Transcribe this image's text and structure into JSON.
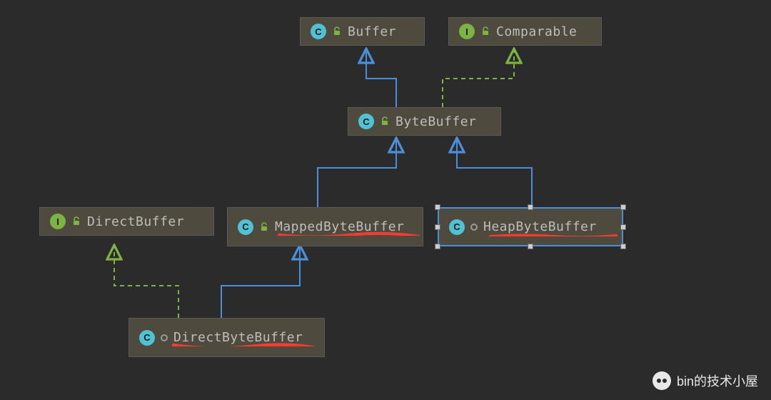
{
  "nodes": {
    "buffer": {
      "label": "Buffer",
      "kind": "class",
      "vis": "lock-open"
    },
    "comparable": {
      "label": "Comparable",
      "kind": "interface",
      "vis": "lock-open"
    },
    "bytebuffer": {
      "label": "ByteBuffer",
      "kind": "class",
      "vis": "lock-open"
    },
    "directbuffer": {
      "label": "DirectBuffer",
      "kind": "interface",
      "vis": "lock-open"
    },
    "mappedbb": {
      "label": "MappedByteBuffer",
      "kind": "class",
      "vis": "lock-open"
    },
    "heapbb": {
      "label": "HeapByteBuffer",
      "kind": "class",
      "vis": "package"
    },
    "directbb": {
      "label": "DirectByteBuffer",
      "kind": "class",
      "vis": "package"
    }
  },
  "edges": [
    {
      "from": "bytebuffer",
      "to": "buffer",
      "style": "extends"
    },
    {
      "from": "bytebuffer",
      "to": "comparable",
      "style": "implements"
    },
    {
      "from": "mappedbb",
      "to": "bytebuffer",
      "style": "extends"
    },
    {
      "from": "heapbb",
      "to": "bytebuffer",
      "style": "extends"
    },
    {
      "from": "directbb",
      "to": "mappedbb",
      "style": "extends"
    },
    {
      "from": "directbb",
      "to": "directbuffer",
      "style": "implements"
    }
  ],
  "selected": "heapbb",
  "highlighted": [
    "mappedbb",
    "heapbb",
    "directbb"
  ],
  "colors": {
    "extends": "#4a90d9",
    "implements": "#7cb342",
    "highlight": "#ff3b30",
    "class_icon": "#4fc3d4",
    "iface_icon": "#7cb342"
  },
  "watermark": "bin的技术小屋"
}
